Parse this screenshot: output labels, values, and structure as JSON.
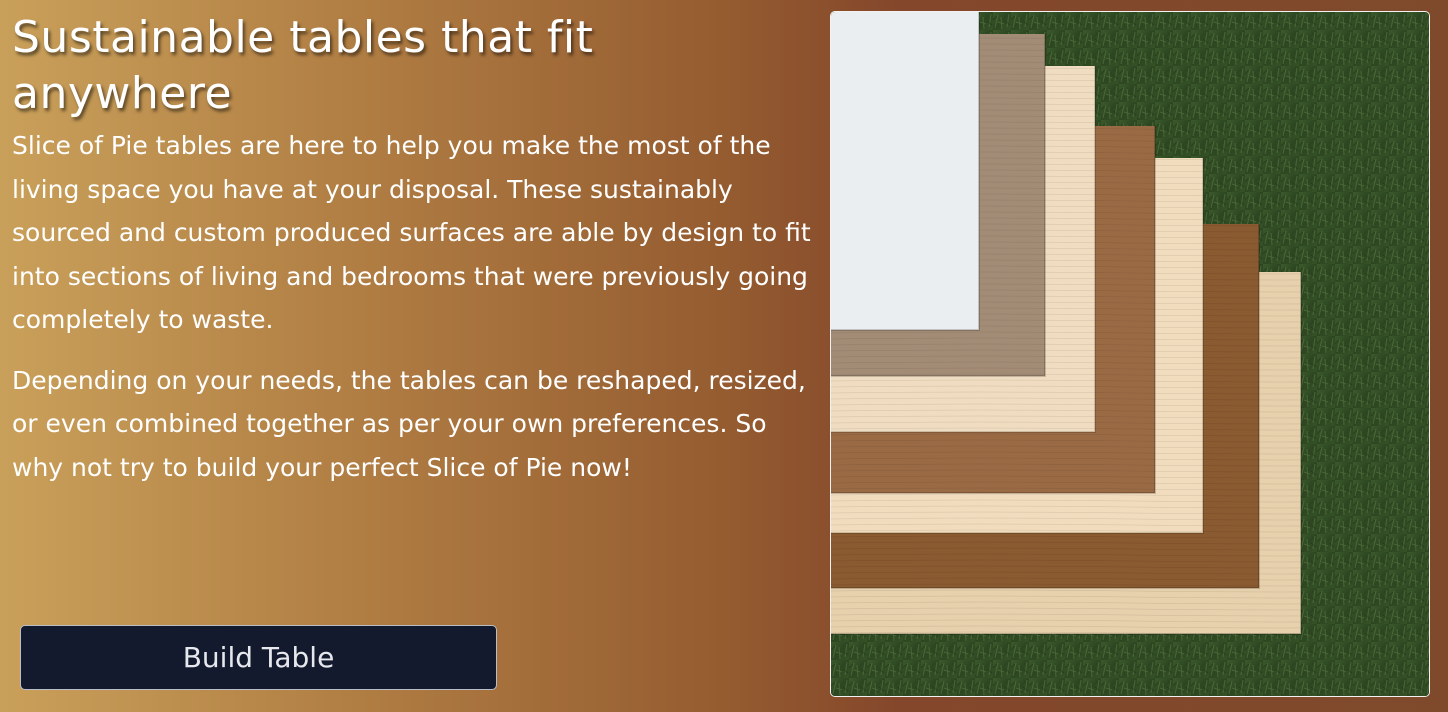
{
  "hero": {
    "title": "Sustainable tables that fit anywhere",
    "paragraphs": [
      "Slice of Pie tables are here to help you make the most of the living space you have at your disposal. These sustainably sourced and custom produced surfaces are able by design to fit into sections of living and bedrooms that were previously going completely to waste.",
      "Depending on your needs, the tables can be reshaped, resized, or even combined together as per your own preferences. So why not try to build your perfect Slice of Pie now!"
    ],
    "button_label": "Build Table"
  },
  "image": {
    "subject": "fanned stack of wood and laminate table-top samples on grass"
  },
  "colors": {
    "gradient_left": "#c9a05a",
    "gradient_right": "#7f4a2c",
    "button_background": "#131a2d",
    "button_text": "#e6e8ee"
  }
}
